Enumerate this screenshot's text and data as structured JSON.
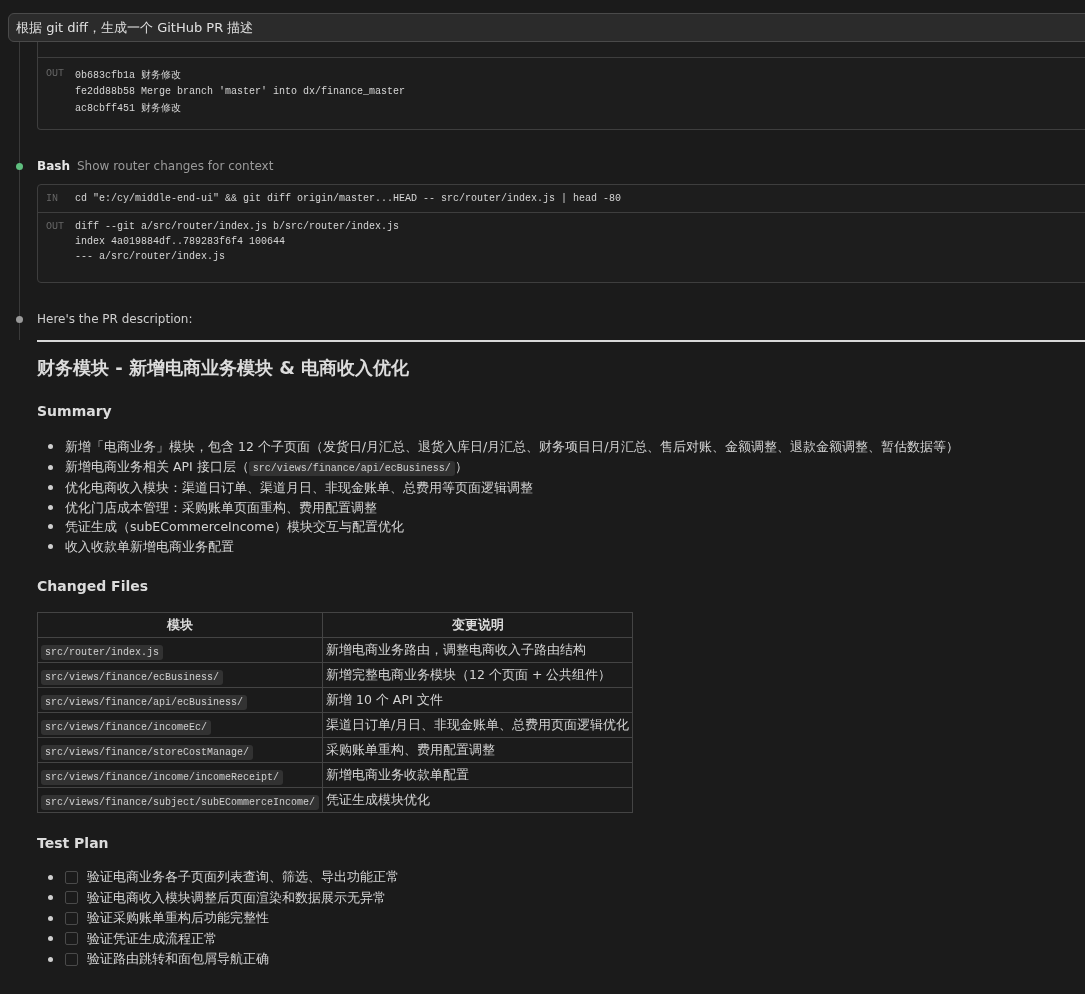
{
  "prompt": {
    "text": "根据 git diff，生成一个 GitHub PR 描述"
  },
  "steps": [
    {
      "kind": "partial",
      "output": {
        "label": "OUT",
        "lines": [
          "0b683cfb1a 财务修改",
          "fe2dd88b58 Merge branch 'master' into dx/finance_master",
          "ac8cbff451 财务修改"
        ]
      }
    },
    {
      "kind": "tool",
      "tool": "Bash",
      "description": "Show router changes for context",
      "color": "#5fbf7f",
      "input": {
        "label": "IN",
        "command": "cd \"e:/cy/middle-end-ui\" && git diff origin/master...HEAD -- src/router/index.js | head -80"
      },
      "output": {
        "label": "OUT",
        "lines": [
          "diff --git a/src/router/index.js b/src/router/index.js",
          "index 4a019884df..789283f6f4 100644",
          "--- a/src/router/index.js"
        ]
      }
    },
    {
      "kind": "message",
      "text": "Here's the PR description:",
      "color": "#9a9a9a"
    }
  ],
  "pr": {
    "title": "财务模块 - 新增电商业务模块 & 电商收入优化",
    "sections": [
      {
        "kind": "bullets",
        "heading": "Summary",
        "items": [
          {
            "parts": [
              {
                "kind": "text",
                "text": "新增「电商业务」模块，包含 12 个子页面（发货日/月汇总、退货入库日/月汇总、财务项目日/月汇总、售后对账、金额调整、退款金额调整、暂估数据等）"
              }
            ]
          },
          {
            "parts": [
              {
                "kind": "text",
                "text": "新增电商业务相关 API 接口层（"
              },
              {
                "kind": "code",
                "text": "src/views/finance/api/ecBusiness/"
              },
              {
                "kind": "text",
                "text": "）"
              }
            ]
          },
          {
            "parts": [
              {
                "kind": "text",
                "text": "优化电商收入模块：渠道日订单、渠道月日、非现金账单、总费用等页面逻辑调整"
              }
            ]
          },
          {
            "parts": [
              {
                "kind": "text",
                "text": "优化门店成本管理：采购账单页面重构、费用配置调整"
              }
            ]
          },
          {
            "parts": [
              {
                "kind": "text",
                "text": "凭证生成（subECommerceIncome）模块交互与配置优化"
              }
            ]
          },
          {
            "parts": [
              {
                "kind": "text",
                "text": "收入收款单新增电商业务配置"
              }
            ]
          }
        ]
      },
      {
        "kind": "table",
        "heading": "Changed Files",
        "columns": [
          "模块",
          "变更说明"
        ],
        "rows": [
          {
            "file": "src/router/index.js",
            "description": "新增电商业务路由，调整电商收入子路由结构"
          },
          {
            "file": "src/views/finance/ecBusiness/",
            "description": "新增完整电商业务模块（12 个页面 + 公共组件）"
          },
          {
            "file": "src/views/finance/api/ecBusiness/",
            "description": "新增 10 个 API 文件"
          },
          {
            "file": "src/views/finance/incomeEc/",
            "description": "渠道日订单/月日、非现金账单、总费用页面逻辑优化"
          },
          {
            "file": "src/views/finance/storeCostManage/",
            "description": "采购账单重构、费用配置调整"
          },
          {
            "file": "src/views/finance/income/incomeReceipt/",
            "description": "新增电商业务收款单配置"
          },
          {
            "file": "src/views/finance/subject/subECommerceIncome/",
            "description": "凭证生成模块优化"
          }
        ]
      },
      {
        "kind": "checklist",
        "heading": "Test Plan",
        "items": [
          {
            "text": "验证电商业务各子页面列表查询、筛选、导出功能正常",
            "checked": false
          },
          {
            "text": "验证电商收入模块调整后页面渲染和数据展示无异常",
            "checked": false
          },
          {
            "text": "验证采购账单重构后功能完整性",
            "checked": false
          },
          {
            "text": "验证凭证生成流程正常",
            "checked": false
          },
          {
            "text": "验证路由跳转和面包屑导航正确",
            "checked": false
          }
        ]
      }
    ]
  }
}
